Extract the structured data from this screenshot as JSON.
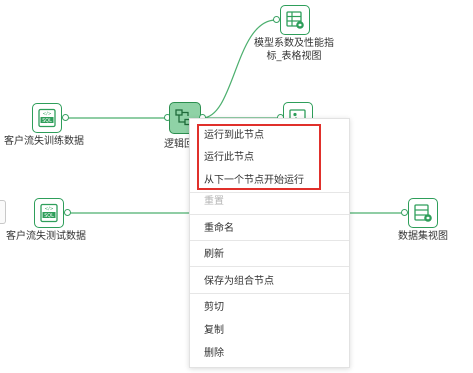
{
  "canvas": {
    "nodes": [
      {
        "id": "train",
        "label": "客户流失训练数据",
        "icon": "sql-icon"
      },
      {
        "id": "logic",
        "label": "逻辑回",
        "icon": "logic-regression-icon"
      },
      {
        "id": "model",
        "label": "模型系数及性能指标_表格视图",
        "icon": "table-view-icon"
      },
      {
        "id": "image",
        "label": "",
        "icon": "image-view-icon"
      },
      {
        "id": "test",
        "label": "客户流失测试数据",
        "icon": "sql-icon"
      },
      {
        "id": "dataset",
        "label": "数据集视图",
        "icon": "dataset-view-icon"
      }
    ],
    "model_label_line1": "模型系数及性能指",
    "model_label_line2": "标_表格视图"
  },
  "context_menu": {
    "run_to_here": "运行到此节点",
    "run_this": "运行此节点",
    "run_from_next": "从下一个节点开始运行",
    "reset": "重置",
    "rename": "重命名",
    "refresh": "刷新",
    "save_as_group": "保存为组合节点",
    "cut": "剪切",
    "copy": "复制",
    "delete": "删除"
  },
  "colors": {
    "accent": "#2e9e5a",
    "selected_node": "#8fd2a6",
    "highlight": "#e0302b",
    "edge": "#4caf6e"
  }
}
